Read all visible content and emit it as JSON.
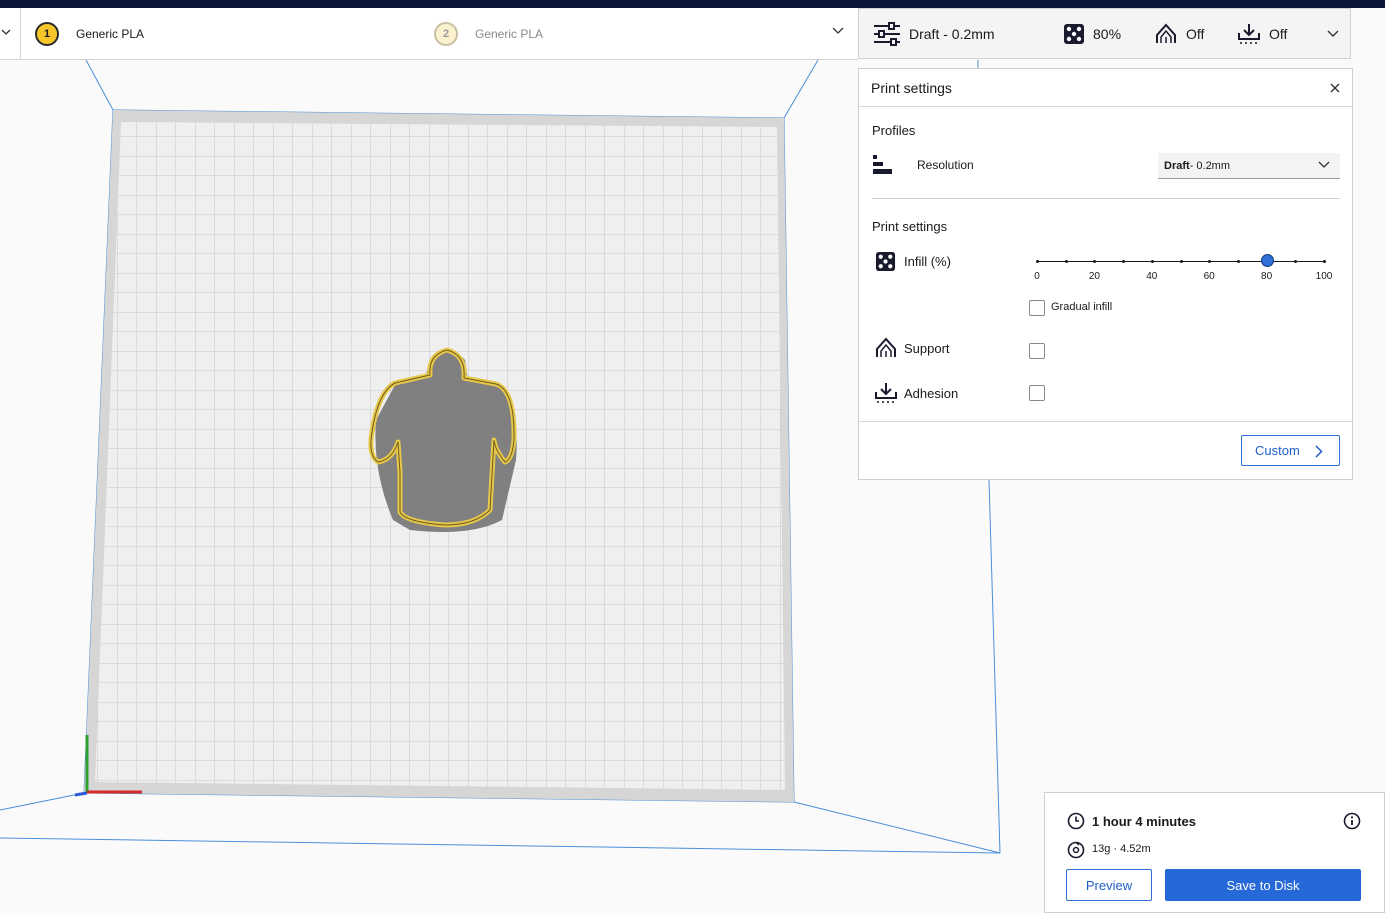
{
  "material_bar": {
    "extruder_1": {
      "number": "1",
      "material": "Generic PLA"
    },
    "extruder_2": {
      "number": "2",
      "material": "Generic PLA"
    }
  },
  "print_bar": {
    "profile": "Draft - 0.2mm",
    "infill": "80%",
    "support": "Off",
    "adhesion": "Off",
    "icons": [
      "settings-sliders-icon",
      "infill-icon",
      "support-icon",
      "adhesion-icon",
      "chevron-down-icon"
    ]
  },
  "panel": {
    "title": "Print settings",
    "profiles_heading": "Profiles",
    "resolution_label": "Resolution",
    "resolution_value_bold": "Draft",
    "resolution_value_rest": " - 0.2mm",
    "settings_heading": "Print settings",
    "infill_label": "Infill (%)",
    "infill_ticks": [
      "0",
      "20",
      "40",
      "60",
      "80",
      "100"
    ],
    "infill_value": 80,
    "gradual_infill_label": "Gradual infill",
    "gradual_infill_checked": false,
    "support_label": "Support",
    "support_checked": false,
    "adhesion_label": "Adhesion",
    "adhesion_checked": false,
    "custom_button": "Custom"
  },
  "estimate": {
    "time": "1 hour 4 minutes",
    "material": "13g · 4.52m",
    "preview_button": "Preview",
    "save_button": "Save to Disk"
  },
  "colors": {
    "accent": "#2568d8",
    "model_outline": "#e8c84a",
    "build_plate": "#eeeeee",
    "top_strip": "#0b1539"
  }
}
